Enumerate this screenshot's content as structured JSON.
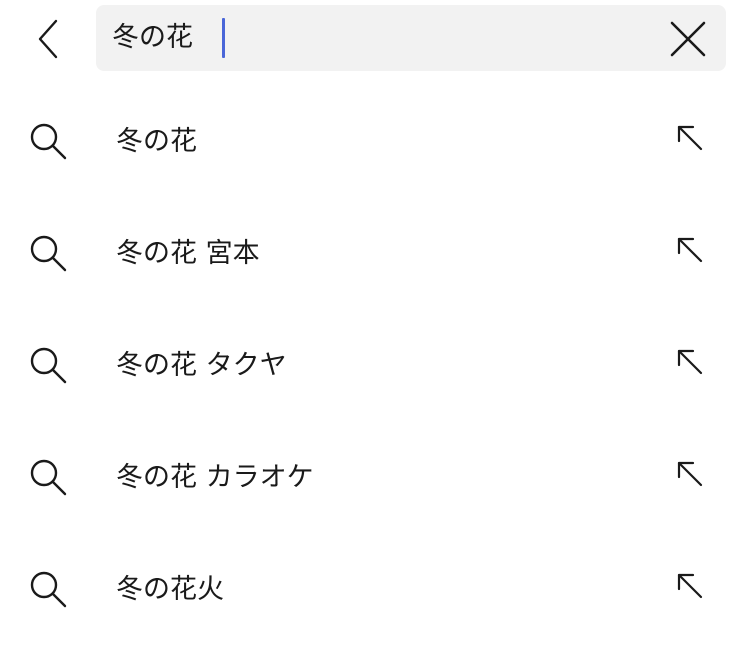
{
  "search": {
    "query": "冬の花"
  },
  "suggestions": [
    {
      "label": "冬の花"
    },
    {
      "label": "冬の花 宮本"
    },
    {
      "label": "冬の花 タクヤ"
    },
    {
      "label": "冬の花 カラオケ"
    },
    {
      "label": "冬の花火"
    }
  ],
  "icons": {
    "back": "chevron-left-icon",
    "clear": "close-icon",
    "suggestion": "search-icon",
    "fill": "arrow-up-left-icon"
  },
  "colors": {
    "caret": "#4a66d8",
    "search_bg": "#f2f2f2",
    "text": "#1a1a1a"
  }
}
